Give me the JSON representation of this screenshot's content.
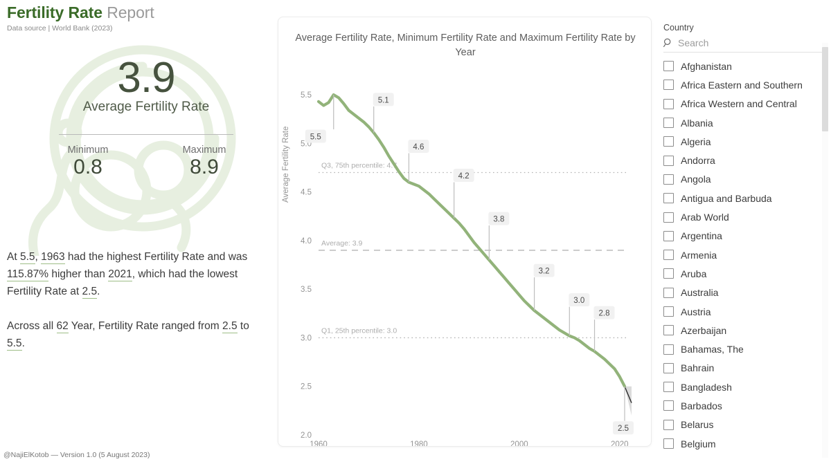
{
  "header": {
    "title_primary": "Fertility Rate",
    "title_secondary": "Report",
    "subtitle": "Data source | World Bank (2023)"
  },
  "kpi": {
    "big_value": "3.9",
    "caption": "Average Fertility Rate",
    "minimum_label": "Minimum",
    "minimum_value": "0.8",
    "maximum_label": "Maximum",
    "maximum_value": "8.9"
  },
  "narrative": {
    "p1_a": "At ",
    "p1_v1": "5.5",
    "p1_b": ", ",
    "p1_v2": "1963",
    "p1_c": " had the highest Fertility Rate and was ",
    "p1_v3": "115.87%",
    "p1_d": " higher than ",
    "p1_v4": "2021",
    "p1_e": ", which had the lowest Fertility Rate at ",
    "p1_v5": "2.5",
    "p1_f": ".",
    "p2_a": "Across all ",
    "p2_v1": "62",
    "p2_b": " Year, Fertility Rate ranged from ",
    "p2_v2": "2.5",
    "p2_c": " to ",
    "p2_v3": "5.5",
    "p2_d": "."
  },
  "footer": {
    "text": "@NajiElKotob — Version 1.0 (5 August 2023)"
  },
  "slicer": {
    "title": "Country",
    "search_placeholder": "Search",
    "search_value": "",
    "search_icon": "search-icon",
    "items": [
      "Afghanistan",
      "Africa Eastern and Southern",
      "Africa Western and Central",
      "Albania",
      "Algeria",
      "Andorra",
      "Angola",
      "Antigua and Barbuda",
      "Arab World",
      "Argentina",
      "Armenia",
      "Aruba",
      "Australia",
      "Austria",
      "Azerbaijan",
      "Bahamas, The",
      "Bahrain",
      "Bangladesh",
      "Barbados",
      "Belarus",
      "Belgium"
    ]
  },
  "colors": {
    "brand_green": "#3a6b28",
    "line_green": "#92b37a",
    "kpi_text": "#46523e",
    "muted": "#9a9a9a",
    "reference_gray": "#b3b3b3",
    "forecast_gray": "#c8c8c8"
  },
  "chart_data": {
    "type": "line",
    "title": "Average Fertility Rate, Minimum Fertility Rate and Maximum Fertility Rate by Year",
    "xlabel": "",
    "ylabel": "Average Fertility Rate",
    "xlim": [
      1960,
      2021
    ],
    "ylim": [
      2.0,
      5.6
    ],
    "y_ticks": [
      "2.0",
      "2.5",
      "3.0",
      "3.5",
      "4.0",
      "4.5",
      "5.0",
      "5.5"
    ],
    "x_ticks": [
      "1960",
      "1980",
      "2000",
      "2020"
    ],
    "grid": false,
    "legend": "none",
    "series": [
      {
        "name": "Average Fertility Rate",
        "color": "#92b37a",
        "x": [
          1960,
          1961,
          1962,
          1963,
          1964,
          1965,
          1966,
          1967,
          1968,
          1969,
          1970,
          1971,
          1972,
          1973,
          1974,
          1975,
          1976,
          1977,
          1978,
          1979,
          1980,
          1981,
          1982,
          1983,
          1984,
          1985,
          1986,
          1987,
          1988,
          1989,
          1990,
          1991,
          1992,
          1993,
          1994,
          1995,
          1996,
          1997,
          1998,
          1999,
          2000,
          2001,
          2002,
          2003,
          2004,
          2005,
          2006,
          2007,
          2008,
          2009,
          2010,
          2011,
          2012,
          2013,
          2014,
          2015,
          2016,
          2017,
          2018,
          2019,
          2020,
          2021
        ],
        "values": [
          5.43,
          5.39,
          5.42,
          5.5,
          5.47,
          5.41,
          5.34,
          5.3,
          5.26,
          5.22,
          5.17,
          5.11,
          5.04,
          4.96,
          4.87,
          4.79,
          4.71,
          4.64,
          4.6,
          4.58,
          4.56,
          4.52,
          4.48,
          4.43,
          4.38,
          4.33,
          4.28,
          4.23,
          4.18,
          4.12,
          4.05,
          3.98,
          3.92,
          3.86,
          3.8,
          3.74,
          3.68,
          3.62,
          3.56,
          3.5,
          3.44,
          3.38,
          3.33,
          3.28,
          3.24,
          3.2,
          3.16,
          3.12,
          3.08,
          3.05,
          3.02,
          3.0,
          2.97,
          2.93,
          2.89,
          2.86,
          2.82,
          2.78,
          2.73,
          2.68,
          2.6,
          2.5
        ]
      }
    ],
    "data_labels": [
      {
        "value": "5.5",
        "year": 1963
      },
      {
        "value": "5.1",
        "year": 1971
      },
      {
        "value": "4.6",
        "year": 1978
      },
      {
        "value": "4.2",
        "year": 1987
      },
      {
        "value": "3.8",
        "year": 1994
      },
      {
        "value": "3.2",
        "year": 2003
      },
      {
        "value": "3.0",
        "year": 2010
      },
      {
        "value": "2.8",
        "year": 2015
      },
      {
        "value": "2.5",
        "year": 2021
      }
    ],
    "reference_lines": [
      {
        "label": "Q3, 75th percentile: 4.7",
        "value": 4.7,
        "style": "dotted"
      },
      {
        "label": "Average: 3.9",
        "value": 3.9,
        "style": "dashed"
      },
      {
        "label": "Q1, 25th percentile: 3.0",
        "value": 3.0,
        "style": "dotted"
      }
    ],
    "forecast": {
      "label": "forecast-cone",
      "start_year": 2021,
      "start_value": 2.5,
      "end_value": 2.33,
      "band_low": 2.2,
      "band_high": 2.5
    }
  }
}
